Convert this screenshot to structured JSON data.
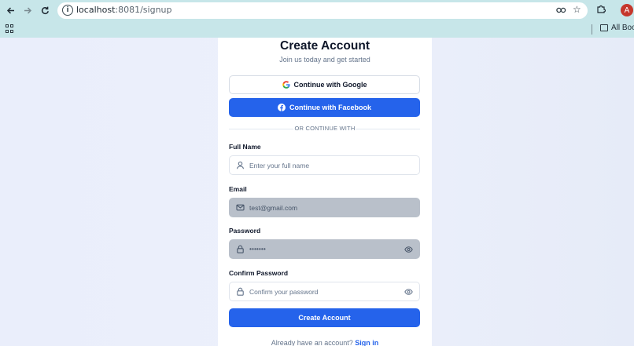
{
  "browser": {
    "url_host": "localhost",
    "url_path": ":8081/signup",
    "avatar_letter": "A",
    "bookmarks_label": "All Bookmarks"
  },
  "form": {
    "title": "Create Account",
    "subtitle": "Join us today and get started",
    "google_button": "Continue with Google",
    "facebook_button": "Continue with Facebook",
    "divider": "OR CONTINUE WITH",
    "full_name": {
      "label": "Full Name",
      "placeholder": "Enter your full name",
      "value": ""
    },
    "email": {
      "label": "Email",
      "placeholder": "",
      "value": "test@gmail.com"
    },
    "password": {
      "label": "Password",
      "value": "•••••••"
    },
    "confirm_password": {
      "label": "Confirm Password",
      "placeholder": "Confirm your password",
      "value": ""
    },
    "submit_button": "Create Account",
    "footer_text": "Already have an account?",
    "footer_link": "Sign in"
  },
  "colors": {
    "primary": "#2563eb",
    "chrome": "#c7e6e9",
    "autofill": "#b9c0ca"
  }
}
